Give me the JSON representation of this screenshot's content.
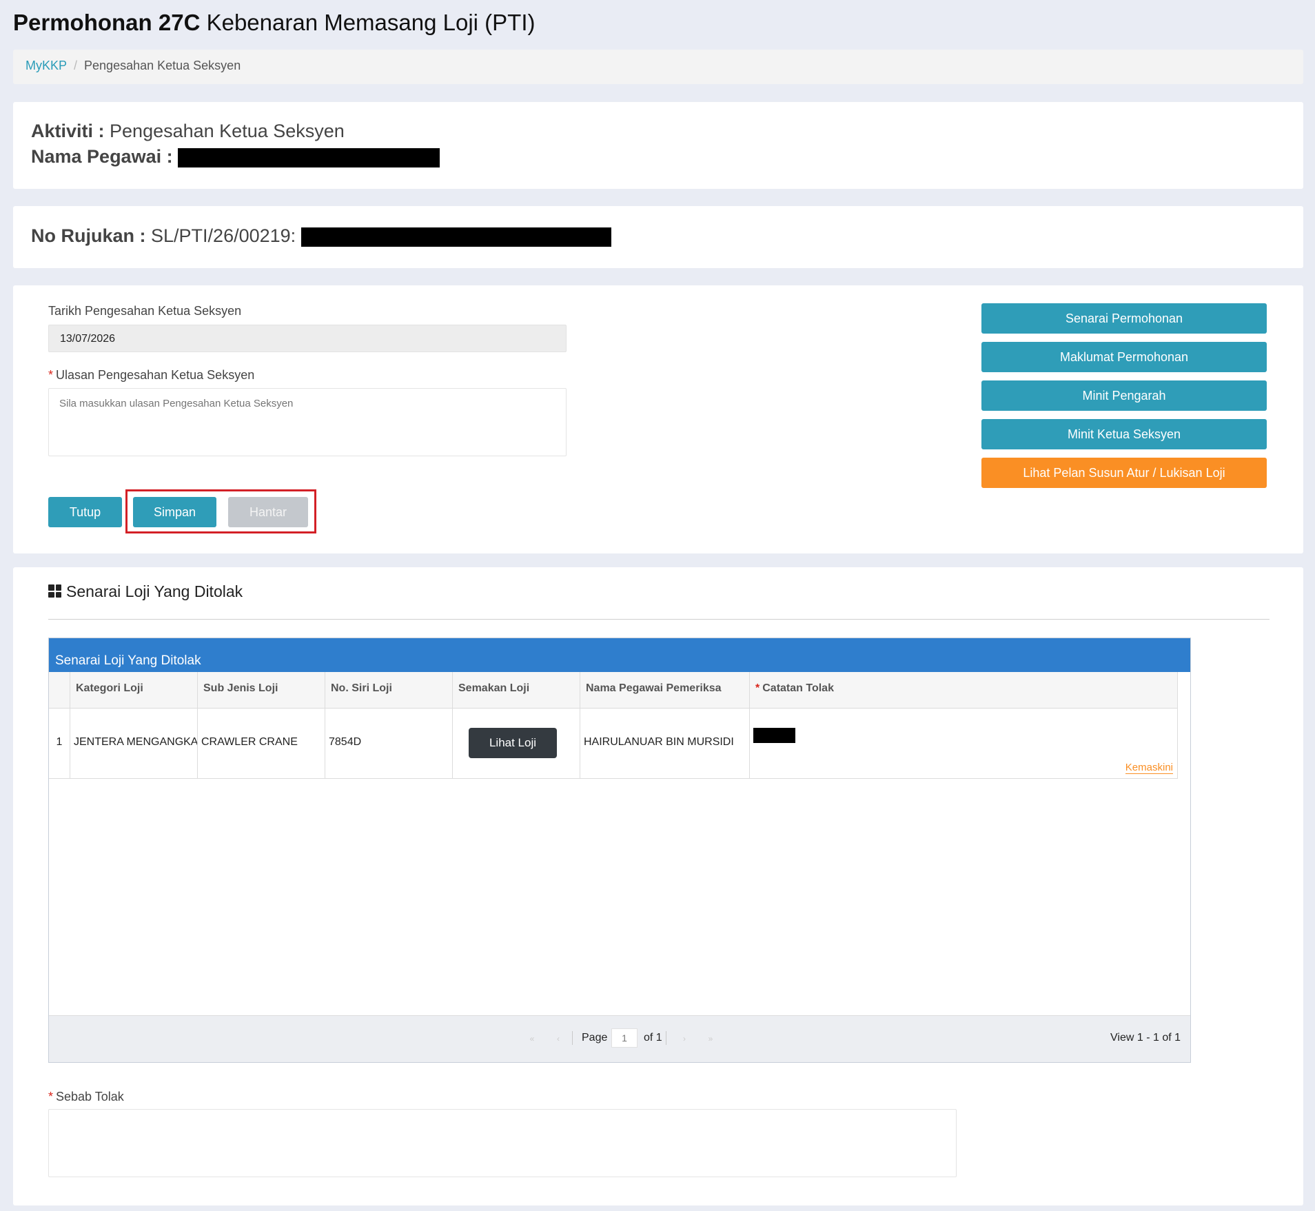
{
  "header": {
    "title_bold": "Permohonan 27C",
    "title_rest": " Kebenaran Memasang Loji (PTI)"
  },
  "breadcrumb": {
    "home": "MyKKP",
    "separator": "/",
    "current": "Pengesahan Ketua Seksyen"
  },
  "activity": {
    "aktiviti_label": "Aktiviti :",
    "aktiviti_value": "Pengesahan Ketua Seksyen",
    "pegawai_label": "Nama Pegawai :"
  },
  "reference": {
    "label": "No Rujukan :",
    "value": "SL/PTI/26/00219:"
  },
  "form": {
    "date_label": "Tarikh Pengesahan Ketua Seksyen",
    "date_value": "13/07/2026",
    "required_mark": "*",
    "ulasan_label": "Ulasan Pengesahan Ketua Seksyen",
    "ulasan_placeholder": "Sila masukkan ulasan Pengesahan Ketua Seksyen",
    "buttons": {
      "tutup": "Tutup",
      "simpan": "Simpan",
      "hantar": "Hantar"
    }
  },
  "side_buttons": {
    "senarai_permohonan": "Senarai Permohonan",
    "maklumat_permohonan": "Maklumat Permohonan",
    "minit_pengarah": "Minit Pengarah",
    "minit_ketua_seksyen": "Minit Ketua Seksyen",
    "lihat_pelan": "Lihat Pelan Susun Atur / Lukisan Loji"
  },
  "rejected": {
    "section_title": "Senarai Loji Yang Ditolak",
    "grid_caption": "Senarai Loji Yang Ditolak",
    "columns": {
      "kategori": "Kategori Loji",
      "sub_jenis": "Sub Jenis Loji",
      "no_siri": "No. Siri Loji",
      "semakan": "Semakan Loji",
      "pegawai": "Nama Pegawai Pemeriksa",
      "catatan": "Catatan Tolak"
    },
    "row": {
      "num": "1",
      "kategori": "JENTERA MENGANGKAT",
      "sub_jenis": "CRAWLER CRANE",
      "no_siri": "7854D",
      "semakan_button": "Lihat Loji",
      "pegawai": "HAIRULANUAR BIN MURSIDI",
      "kemaskini": "Kemaskini"
    },
    "pager": {
      "page_label": "Page",
      "page_value": "1",
      "of_label": "of 1",
      "view": "View 1 - 1 of 1"
    },
    "sebab_label": "Sebab Tolak"
  },
  "colors": {
    "teal": "#2f9db8",
    "orange": "#fa8f24",
    "grid_header": "#2f7ecd",
    "highlight": "#d32026"
  }
}
